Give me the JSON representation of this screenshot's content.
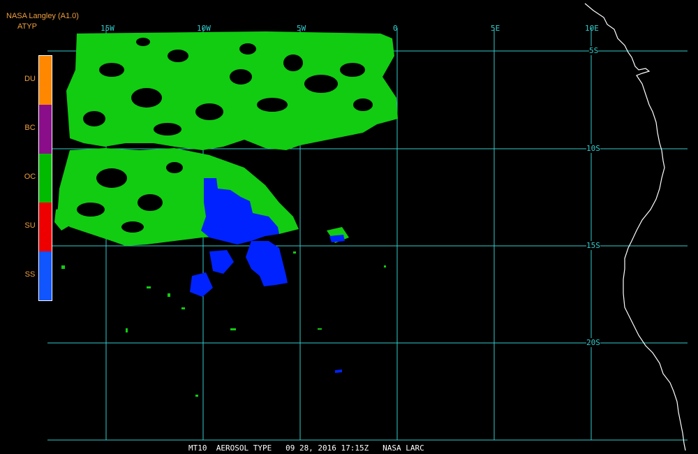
{
  "header": {
    "source": "NASA Langley (A1.0)",
    "product": "ATYP"
  },
  "legend": {
    "entries": [
      {
        "code": "DU",
        "color": "#ff8800"
      },
      {
        "code": "BC",
        "color": "#8a0e8a"
      },
      {
        "code": "OC",
        "color": "#00bb00"
      },
      {
        "code": "SU",
        "color": "#ee0000"
      },
      {
        "code": "SS",
        "color": "#1155ff"
      }
    ]
  },
  "map": {
    "longitude_labels": [
      "15W",
      "10W",
      "5W",
      "0",
      "5E",
      "10E"
    ],
    "latitude_labels": [
      "5S",
      "10S",
      "15S",
      "20S"
    ],
    "grid_color": "#33cccc",
    "coast_color": "#ffffff",
    "oc_color": "#11cc11",
    "ss_color": "#0022ff"
  },
  "footer": {
    "caption": "MT10  AEROSOL TYPE   09 28, 2016 17:15Z   NASA LARC"
  }
}
